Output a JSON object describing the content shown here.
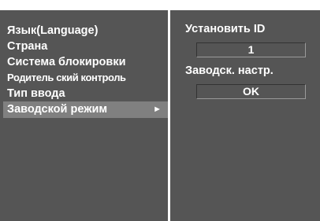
{
  "menu": {
    "items": [
      {
        "label": "Язык(Language)"
      },
      {
        "label": "Страна"
      },
      {
        "label": "Система блокировки"
      },
      {
        "label": "Родитель ский контроль"
      },
      {
        "label": "Тип ввода"
      },
      {
        "label": "Заводской режим",
        "selected": true
      }
    ],
    "arrow": "►"
  },
  "settings": {
    "set_id_label": "Установить ID",
    "set_id_value": "1",
    "factory_reset_label": "Заводск. настр.",
    "factory_reset_button": "OK"
  },
  "colors": {
    "panel": "#555555",
    "selected": "#808080",
    "text": "#ffffff",
    "background": "#ffffff"
  }
}
